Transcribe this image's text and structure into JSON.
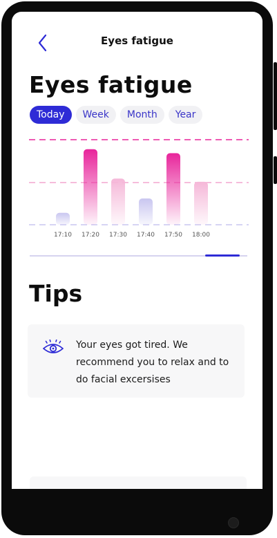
{
  "header": {
    "title": "Eyes fatigue"
  },
  "page": {
    "title": "Eyes fatigue"
  },
  "tabs": [
    {
      "label": "Today",
      "active": true
    },
    {
      "label": "Week",
      "active": false
    },
    {
      "label": "Month",
      "active": false
    },
    {
      "label": "Year",
      "active": false
    }
  ],
  "chart_data": {
    "type": "bar",
    "categories": [
      "17:10",
      "17:20",
      "17:30",
      "17:40",
      "17:50",
      "18:00"
    ],
    "values": [
      15,
      95,
      58,
      33,
      90,
      54
    ],
    "ylim": [
      0,
      100
    ],
    "grid": true,
    "colors": {
      "high": "#e8259b",
      "low": "#c9c6f0",
      "grid_top": "#e8259b",
      "grid_mid": "#f3a6cf",
      "grid_low": "#c9c6f0"
    }
  },
  "tips": {
    "title": "Tips",
    "items": [
      {
        "icon": "eye-icon",
        "text": "Your eyes got tired. We recommend you to relax and to do facial excersises"
      }
    ]
  },
  "colors": {
    "accent": "#2e2bd6"
  }
}
